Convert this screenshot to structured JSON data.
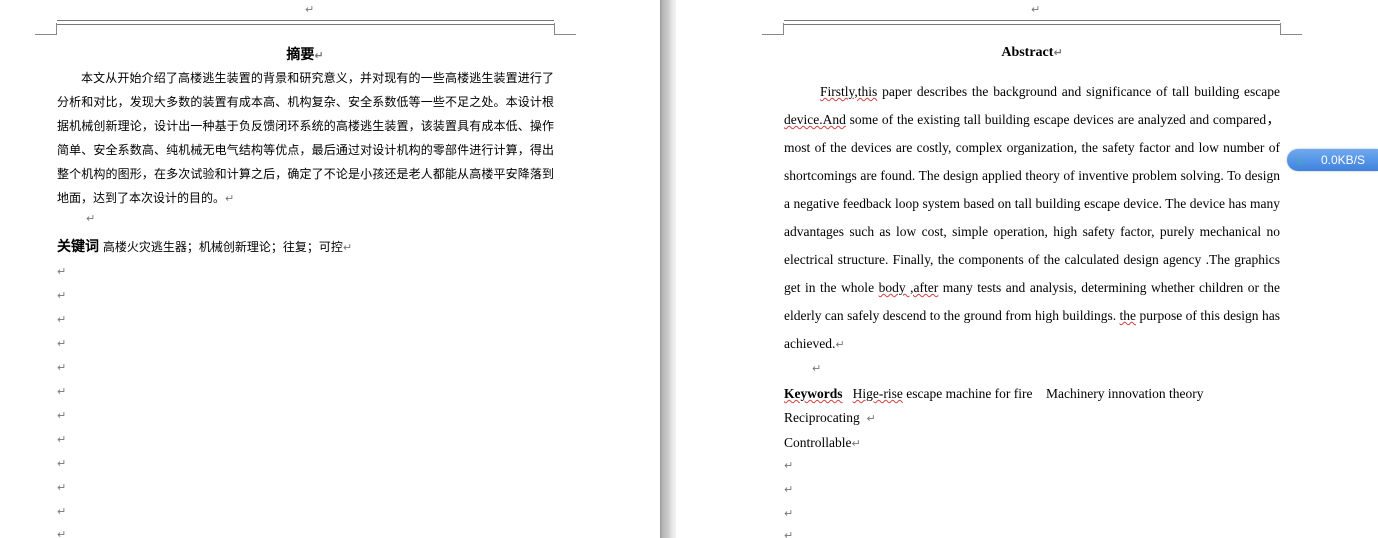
{
  "paragraph_mark": "↵",
  "chinese_page": {
    "title": "摘要",
    "body": "本文从开始介绍了高楼逃生装置的背景和研究意义，并对现有的一些高楼逃生装置进行了分析和对比，发现大多数的装置有成本高、机构复杂、安全系数低等一些不足之处。本设计根据机械创新理论，设计出一种基于负反馈闭环系统的高楼逃生装置，该装置具有成本低、操作简单、安全系数高、纯机械无电气结构等优点，最后通过对设计机构的零部件进行计算，得出整个机构的图形，在多次试验和计算之后，确定了不论是小孩还是老人都能从高楼平安降落到地面，达到了本次设计的目的。",
    "keywords_label": "关键词",
    "keywords": "高楼火灾逃生器；机械创新理论；往复；可控"
  },
  "english_page": {
    "title": "Abstract",
    "body_spell_1": "Firstly,this",
    "body_1": " paper describes the background and significance of tall building escape ",
    "body_spell_2": "device.And",
    "body_2": " some of the existing tall building escape devices are analyzed and compared，most of the devices are costly, complex organization, the safety factor and low number of shortcomings are found. The design applied theory of inventive problem solving. To design a negative feedback loop system based on tall building escape device. The device has many advantages such as low cost, simple operation, high safety factor, purely mechanical no electrical structure. Finally, the components of the calculated design agency .The graphics get in the whole ",
    "body_spell_3": "body ,after",
    "body_3": " many tests and analysis, determining whether children or the elderly can safely descend to the ground from high buildings. ",
    "body_spell_4": "the",
    "body_4": " purpose of this design has achieved.",
    "keywords_label": "Keywords",
    "keyword_1_spell": "Hige-rise",
    "keyword_1_rest": " escape machine for fire",
    "keyword_2": "Machinery innovation theory",
    "keyword_3": "Reciprocating",
    "keyword_4": "Controllable"
  },
  "download_widget": {
    "speed": "0.0KB/S",
    "icon": "download-arrow-icon",
    "color": "#4a8ce3"
  }
}
